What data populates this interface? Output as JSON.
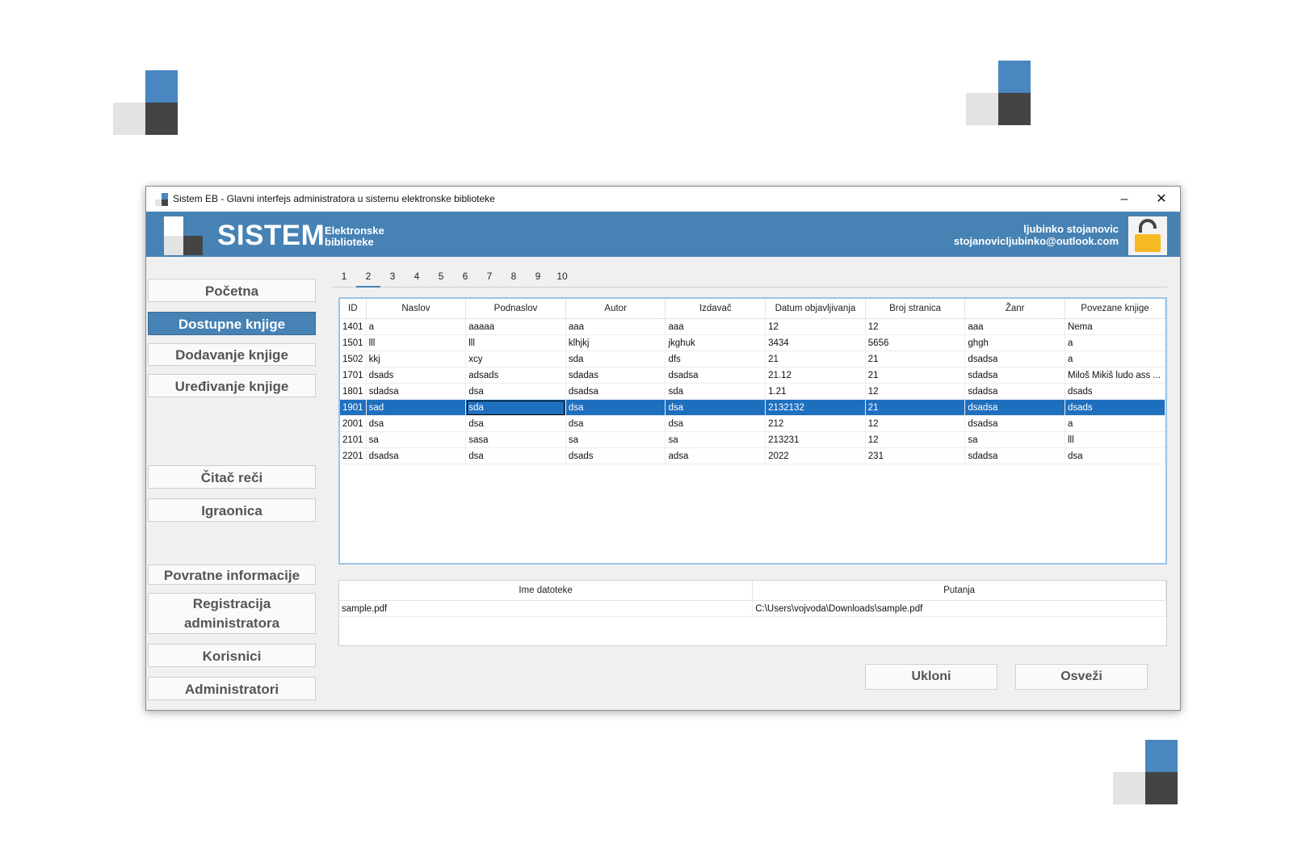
{
  "window": {
    "title": "Sistem EB - Glavni interfejs administratora u sistemu elektronske biblioteke",
    "minimize_glyph": "–",
    "close_glyph": "✕"
  },
  "header": {
    "brand": "SISTEM",
    "subtitle_line1": "Elektronske",
    "subtitle_line2": "biblioteke",
    "user_name": "ljubinko stojanovic",
    "user_email": "stojanovicljubinko@outlook.com",
    "lock_icon": "unlocked-padlock-icon"
  },
  "colors": {
    "accent": "#4682b4",
    "selection": "#1f6fbf",
    "lock": "#f6b823"
  },
  "sidebar": {
    "items": [
      {
        "label": "Početna",
        "active": false
      },
      {
        "label": "Dostupne knjige",
        "active": true
      },
      {
        "label": "Dodavanje knjige",
        "active": false
      },
      {
        "label": "Uređivanje knjige",
        "active": false
      },
      {
        "label": "Čitač reči",
        "active": false
      },
      {
        "label": "Igraonica",
        "active": false
      },
      {
        "label": "Povratne informacije",
        "active": false
      },
      {
        "label": "Registracija administratora",
        "active": false
      },
      {
        "label": "Korisnici",
        "active": false
      },
      {
        "label": "Administratori",
        "active": false
      }
    ]
  },
  "pages": {
    "labels": [
      "1",
      "2",
      "3",
      "4",
      "5",
      "6",
      "7",
      "8",
      "9",
      "10"
    ],
    "selected": "2"
  },
  "books_table": {
    "columns": [
      "ID",
      "Naslov",
      "Podnaslov",
      "Autor",
      "Izdavač",
      "Datum objavljivanja",
      "Broj stranica",
      "Žanr",
      "Povezane knjige"
    ],
    "rows": [
      [
        "1401",
        "a",
        "aaaaa",
        "aaa",
        "aaa",
        "12",
        "12",
        "aaa",
        "Nema"
      ],
      [
        "1501",
        "lll",
        "lll",
        "klhjkj",
        "jkghuk",
        "3434",
        "5656",
        "ghgh",
        "a"
      ],
      [
        "1502",
        "kkj",
        "xcy",
        "sda",
        "dfs",
        "21",
        "21",
        "dsadsa",
        "a"
      ],
      [
        "1701",
        "dsads",
        "adsads",
        "sdadas",
        "dsadsa",
        "21.12",
        "21",
        "sdadsa",
        "Miloš Mikiš ludo ass ..."
      ],
      [
        "1801",
        "sdadsa",
        "dsa",
        "dsadsa",
        "sda",
        "1.21",
        "12",
        "sdadsa",
        "dsads"
      ],
      [
        "1901",
        "sad",
        "sda",
        "dsa",
        "dsa",
        "2132132",
        "21",
        "dsadsa",
        "dsads"
      ],
      [
        "2001",
        "dsa",
        "dsa",
        "dsa",
        "dsa",
        "212",
        "12",
        "dsadsa",
        "a"
      ],
      [
        "2101",
        "sa",
        "sasa",
        "sa",
        "sa",
        "213231",
        "12",
        "sa",
        "lll"
      ],
      [
        "2201",
        "dsadsa",
        "dsa",
        "dsads",
        "adsa",
        "2022",
        "231",
        "sdadsa",
        "dsa"
      ]
    ],
    "selected_row_id": "1901"
  },
  "files_table": {
    "columns": [
      "Ime datoteke",
      "Putanja"
    ],
    "rows": [
      [
        "sample.pdf",
        "C:\\Users\\vojvoda\\Downloads\\sample.pdf"
      ]
    ]
  },
  "actions": {
    "remove_label": "Ukloni",
    "refresh_label": "Osveži"
  }
}
